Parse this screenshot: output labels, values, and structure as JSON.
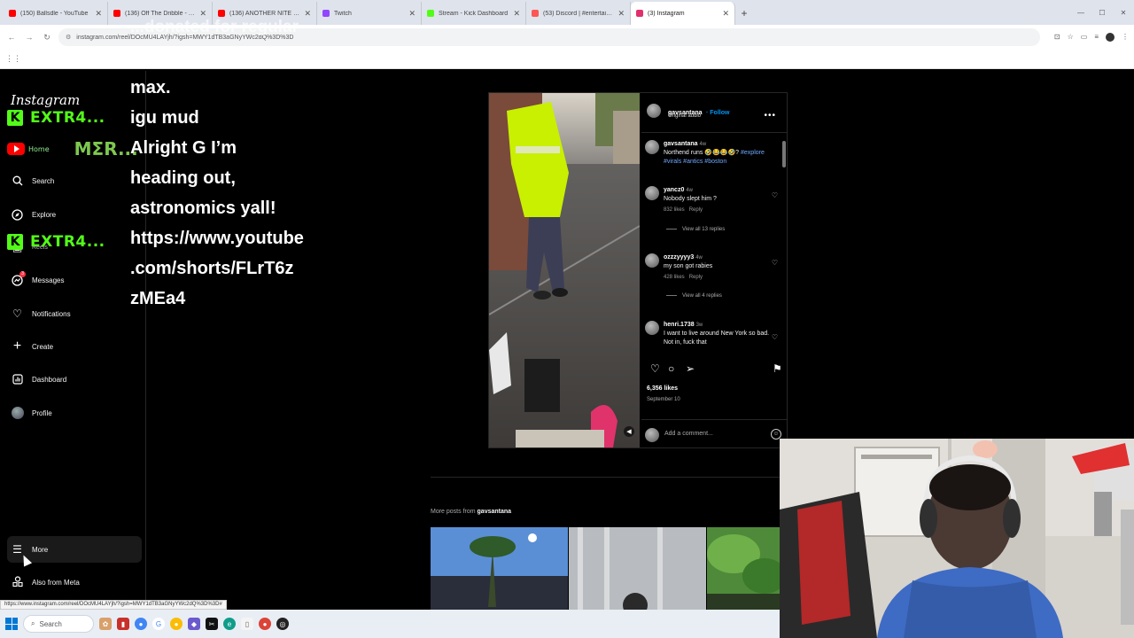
{
  "browser": {
    "tabs": [
      {
        "title": "(150) Ballsdle - YouTube",
        "color": "#ff0000"
      },
      {
        "title": "(136) Off The Dribble - YouTube",
        "color": "#ff0000"
      },
      {
        "title": "(136) ANOTHER NITE STREAM!",
        "color": "#ff0000"
      },
      {
        "title": "Twitch",
        "color": "#9146ff"
      },
      {
        "title": "Stream - Kick Dashboard",
        "color": "#53fc18"
      },
      {
        "title": "(53) Discord | #entertainment",
        "color": "#ff5555"
      },
      {
        "title": "(3) Instagram",
        "color": "#e1306c"
      }
    ],
    "url": "instagram.com/reel/DOcMU4LAYjh/?igsh=MWY1dTB3aGNyYWc2dQ%3D%3D",
    "status_url": "https://www.instagram.com/reel/DOcMU4LAYjh/?igsh=MWY1dTB3aGNyYWc2dQ%3D%3D#"
  },
  "sidebar": {
    "logo": "Instagram",
    "items": [
      {
        "label": "Home",
        "icon": "home-icon"
      },
      {
        "label": "Search",
        "icon": "search-icon"
      },
      {
        "label": "Explore",
        "icon": "compass-icon"
      },
      {
        "label": "Reels",
        "icon": "reels-icon"
      },
      {
        "label": "Messages",
        "icon": "messenger-icon",
        "badge": "3"
      },
      {
        "label": "Notifications",
        "icon": "heart-icon"
      },
      {
        "label": "Create",
        "icon": "plus-icon"
      },
      {
        "label": "Dashboard",
        "icon": "dashboard-icon"
      },
      {
        "label": "Profile",
        "icon": "profile-avatar"
      }
    ],
    "more": "More",
    "also_from_meta": "Also from Meta"
  },
  "overlays": {
    "kick_name_1": "EXTR4...",
    "kick_name_2": "EXTR4...",
    "yt_name": "MΣR...",
    "chat_ghost": [
      "...donated for regular",
      "videos are 13 mins"
    ],
    "chat_lines": [
      "max.",
      "igu mud",
      "Alright G I’m",
      "heading out,",
      "astronomics yall!",
      "https://www.youtube",
      ".com/shorts/FLrT6z",
      "zMEa4"
    ]
  },
  "post": {
    "username": "gavsantana",
    "follow": "Follow",
    "audio": "Original audio",
    "caption_user": "gavsantana",
    "caption_time": "4w",
    "caption_text": "Northend runs 🤣😂😂🤣?",
    "caption_tags": "#explore #virals #antics #boston",
    "comments": [
      {
        "user": "yancz0",
        "time": "4w",
        "text": "Nobody slept him ?",
        "likes": "832 likes",
        "reply": "Reply",
        "view": "View all 13 replies"
      },
      {
        "user": "ozzzyyyy3",
        "time": "4w",
        "text": "my son got rabies",
        "likes": "428 likes",
        "reply": "Reply",
        "view": "View all 4 replies"
      },
      {
        "user": "henri.1738",
        "time": "3w",
        "text": "I want to live around New York so bad. Not in, fuck that"
      }
    ],
    "likes_count": "6,356 likes",
    "date": "September 10",
    "add_comment": "Add a comment...",
    "more_posts_prefix": "More posts from",
    "more_posts_user": "gavsantana"
  },
  "taskbar": {
    "search": "Search"
  }
}
